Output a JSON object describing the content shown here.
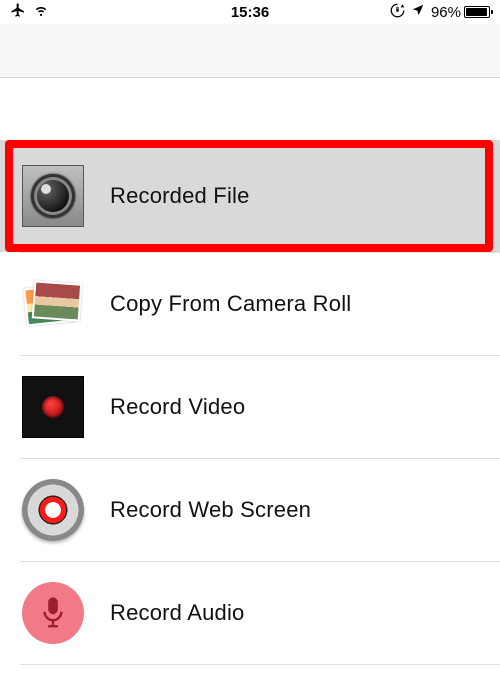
{
  "status": {
    "time": "15:36",
    "battery_pct": "96%",
    "battery_fill_pct": 96
  },
  "menu": {
    "items": [
      {
        "id": "recorded-file",
        "label": "Recorded File",
        "icon": "camera-lens-icon",
        "selected": true
      },
      {
        "id": "copy-camera-roll",
        "label": "Copy From Camera Roll",
        "icon": "photos-stack-icon",
        "selected": false
      },
      {
        "id": "record-video",
        "label": "Record Video",
        "icon": "record-video-icon",
        "selected": false
      },
      {
        "id": "record-web-screen",
        "label": "Record Web Screen",
        "icon": "record-disc-icon",
        "selected": false
      },
      {
        "id": "record-audio",
        "label": "Record Audio",
        "icon": "microphone-icon",
        "selected": false
      }
    ]
  }
}
